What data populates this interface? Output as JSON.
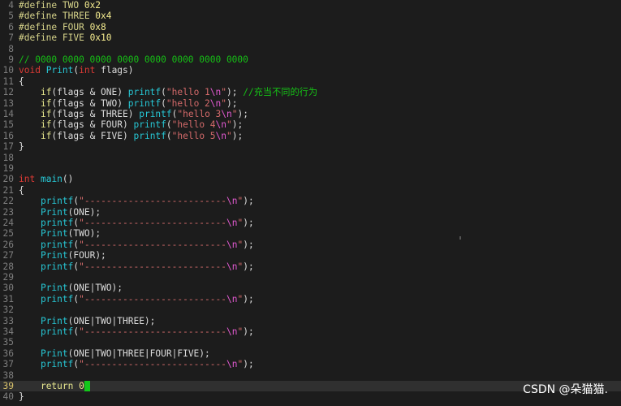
{
  "editor": {
    "current_line": 39,
    "lines": [
      {
        "n": "4",
        "tokens": [
          {
            "t": "#define TWO ",
            "c": "pp"
          },
          {
            "t": "0x2",
            "c": "num"
          }
        ]
      },
      {
        "n": "5",
        "tokens": [
          {
            "t": "#define THREE ",
            "c": "pp"
          },
          {
            "t": "0x4",
            "c": "num"
          }
        ]
      },
      {
        "n": "6",
        "tokens": [
          {
            "t": "#define FOUR ",
            "c": "pp"
          },
          {
            "t": "0x8",
            "c": "num"
          }
        ]
      },
      {
        "n": "7",
        "tokens": [
          {
            "t": "#define FIVE ",
            "c": "pp"
          },
          {
            "t": "0x10",
            "c": "num"
          }
        ]
      },
      {
        "n": "8",
        "tokens": []
      },
      {
        "n": "9",
        "tokens": [
          {
            "t": "// 0000 0000 0000 0000 0000 0000 0000 0000",
            "c": "cm"
          }
        ]
      },
      {
        "n": "10",
        "tokens": [
          {
            "t": "void",
            "c": "ty"
          },
          {
            "t": " "
          },
          {
            "t": "Print",
            "c": "fn"
          },
          {
            "t": "("
          },
          {
            "t": "int",
            "c": "ty"
          },
          {
            "t": " flags)"
          }
        ]
      },
      {
        "n": "11",
        "tokens": [
          {
            "t": "{"
          }
        ]
      },
      {
        "n": "12",
        "tokens": [
          {
            "t": "    "
          },
          {
            "t": "if",
            "c": "kw"
          },
          {
            "t": "(flags & ONE) "
          },
          {
            "t": "printf",
            "c": "fn"
          },
          {
            "t": "("
          },
          {
            "t": "\"hello 1",
            "c": "str"
          },
          {
            "t": "\\n",
            "c": "esc"
          },
          {
            "t": "\"",
            "c": "str"
          },
          {
            "t": "); "
          },
          {
            "t": "//充当不同的行为",
            "c": "cm"
          }
        ]
      },
      {
        "n": "13",
        "tokens": [
          {
            "t": "    "
          },
          {
            "t": "if",
            "c": "kw"
          },
          {
            "t": "(flags & TWO) "
          },
          {
            "t": "printf",
            "c": "fn"
          },
          {
            "t": "("
          },
          {
            "t": "\"hello 2",
            "c": "str"
          },
          {
            "t": "\\n",
            "c": "esc"
          },
          {
            "t": "\"",
            "c": "str"
          },
          {
            "t": ");"
          }
        ]
      },
      {
        "n": "14",
        "tokens": [
          {
            "t": "    "
          },
          {
            "t": "if",
            "c": "kw"
          },
          {
            "t": "(flags & THREE) "
          },
          {
            "t": "printf",
            "c": "fn"
          },
          {
            "t": "("
          },
          {
            "t": "\"hello 3",
            "c": "str"
          },
          {
            "t": "\\n",
            "c": "esc"
          },
          {
            "t": "\"",
            "c": "str"
          },
          {
            "t": ");"
          }
        ]
      },
      {
        "n": "15",
        "tokens": [
          {
            "t": "    "
          },
          {
            "t": "if",
            "c": "kw"
          },
          {
            "t": "(flags & FOUR) "
          },
          {
            "t": "printf",
            "c": "fn"
          },
          {
            "t": "("
          },
          {
            "t": "\"hello 4",
            "c": "str"
          },
          {
            "t": "\\n",
            "c": "esc"
          },
          {
            "t": "\"",
            "c": "str"
          },
          {
            "t": ");"
          }
        ]
      },
      {
        "n": "16",
        "tokens": [
          {
            "t": "    "
          },
          {
            "t": "if",
            "c": "kw"
          },
          {
            "t": "(flags & FIVE) "
          },
          {
            "t": "printf",
            "c": "fn"
          },
          {
            "t": "("
          },
          {
            "t": "\"hello 5",
            "c": "str"
          },
          {
            "t": "\\n",
            "c": "esc"
          },
          {
            "t": "\"",
            "c": "str"
          },
          {
            "t": ");"
          }
        ]
      },
      {
        "n": "17",
        "tokens": [
          {
            "t": "}"
          }
        ]
      },
      {
        "n": "18",
        "tokens": []
      },
      {
        "n": "19",
        "tokens": []
      },
      {
        "n": "20",
        "tokens": [
          {
            "t": "int",
            "c": "ty"
          },
          {
            "t": " "
          },
          {
            "t": "main",
            "c": "fn"
          },
          {
            "t": "()"
          }
        ]
      },
      {
        "n": "21",
        "tokens": [
          {
            "t": "{"
          }
        ]
      },
      {
        "n": "22",
        "tokens": [
          {
            "t": "    "
          },
          {
            "t": "printf",
            "c": "fn"
          },
          {
            "t": "("
          },
          {
            "t": "\"--------------------------",
            "c": "str"
          },
          {
            "t": "\\n",
            "c": "esc"
          },
          {
            "t": "\"",
            "c": "str"
          },
          {
            "t": ");"
          }
        ]
      },
      {
        "n": "23",
        "tokens": [
          {
            "t": "    "
          },
          {
            "t": "Print",
            "c": "fn"
          },
          {
            "t": "(ONE);"
          }
        ]
      },
      {
        "n": "24",
        "tokens": [
          {
            "t": "    "
          },
          {
            "t": "printf",
            "c": "fn"
          },
          {
            "t": "("
          },
          {
            "t": "\"--------------------------",
            "c": "str"
          },
          {
            "t": "\\n",
            "c": "esc"
          },
          {
            "t": "\"",
            "c": "str"
          },
          {
            "t": ");"
          }
        ]
      },
      {
        "n": "25",
        "tokens": [
          {
            "t": "    "
          },
          {
            "t": "Print",
            "c": "fn"
          },
          {
            "t": "(TWO);"
          }
        ]
      },
      {
        "n": "26",
        "tokens": [
          {
            "t": "    "
          },
          {
            "t": "printf",
            "c": "fn"
          },
          {
            "t": "("
          },
          {
            "t": "\"--------------------------",
            "c": "str"
          },
          {
            "t": "\\n",
            "c": "esc"
          },
          {
            "t": "\"",
            "c": "str"
          },
          {
            "t": ");"
          }
        ]
      },
      {
        "n": "27",
        "tokens": [
          {
            "t": "    "
          },
          {
            "t": "Print",
            "c": "fn"
          },
          {
            "t": "(FOUR);"
          }
        ]
      },
      {
        "n": "28",
        "tokens": [
          {
            "t": "    "
          },
          {
            "t": "printf",
            "c": "fn"
          },
          {
            "t": "("
          },
          {
            "t": "\"--------------------------",
            "c": "str"
          },
          {
            "t": "\\n",
            "c": "esc"
          },
          {
            "t": "\"",
            "c": "str"
          },
          {
            "t": ");"
          }
        ]
      },
      {
        "n": "29",
        "tokens": []
      },
      {
        "n": "30",
        "tokens": [
          {
            "t": "    "
          },
          {
            "t": "Print",
            "c": "fn"
          },
          {
            "t": "(ONE|TWO);"
          }
        ]
      },
      {
        "n": "31",
        "tokens": [
          {
            "t": "    "
          },
          {
            "t": "printf",
            "c": "fn"
          },
          {
            "t": "("
          },
          {
            "t": "\"--------------------------",
            "c": "str"
          },
          {
            "t": "\\n",
            "c": "esc"
          },
          {
            "t": "\"",
            "c": "str"
          },
          {
            "t": ");"
          }
        ]
      },
      {
        "n": "32",
        "tokens": []
      },
      {
        "n": "33",
        "tokens": [
          {
            "t": "    "
          },
          {
            "t": "Print",
            "c": "fn"
          },
          {
            "t": "(ONE|TWO|THREE);"
          }
        ]
      },
      {
        "n": "34",
        "tokens": [
          {
            "t": "    "
          },
          {
            "t": "printf",
            "c": "fn"
          },
          {
            "t": "("
          },
          {
            "t": "\"--------------------------",
            "c": "str"
          },
          {
            "t": "\\n",
            "c": "esc"
          },
          {
            "t": "\"",
            "c": "str"
          },
          {
            "t": ");"
          }
        ]
      },
      {
        "n": "35",
        "tokens": []
      },
      {
        "n": "36",
        "tokens": [
          {
            "t": "    "
          },
          {
            "t": "Print",
            "c": "fn"
          },
          {
            "t": "(ONE|TWO|THREE|FOUR|FIVE);"
          }
        ]
      },
      {
        "n": "37",
        "tokens": [
          {
            "t": "    "
          },
          {
            "t": "printf",
            "c": "fn"
          },
          {
            "t": "("
          },
          {
            "t": "\"--------------------------",
            "c": "str"
          },
          {
            "t": "\\n",
            "c": "esc"
          },
          {
            "t": "\"",
            "c": "str"
          },
          {
            "t": ");"
          }
        ]
      },
      {
        "n": "38",
        "tokens": []
      },
      {
        "n": "39",
        "tokens": [
          {
            "t": "    "
          },
          {
            "t": "return",
            "c": "kw"
          },
          {
            "t": " "
          },
          {
            "t": "0",
            "c": "num"
          },
          {
            "t": ";",
            "c": "cursor"
          }
        ]
      },
      {
        "n": "40",
        "tokens": [
          {
            "t": "}"
          }
        ]
      }
    ]
  },
  "watermark": "CSDN @朵猫猫."
}
